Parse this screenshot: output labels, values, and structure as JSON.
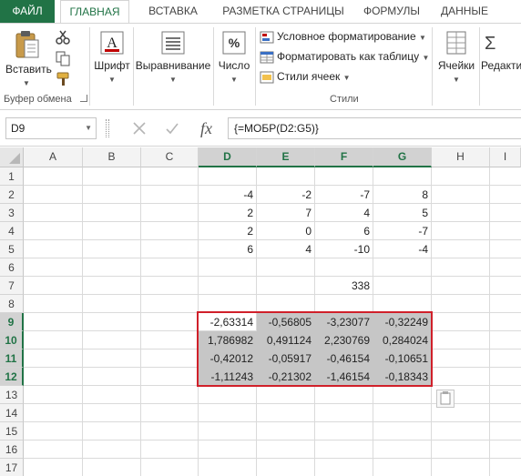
{
  "tabs": {
    "file": "ФАЙЛ",
    "home": "ГЛАВНАЯ",
    "insert": "ВСТАВКА",
    "page_layout": "РАЗМЕТКА СТРАНИЦЫ",
    "formulas": "ФОРМУЛЫ",
    "data": "ДАННЫЕ"
  },
  "ribbon": {
    "paste_label": "Вставить",
    "clipboard_group": "Буфер обмена",
    "font_label": "Шрифт",
    "alignment_label": "Выравнивание",
    "number_label": "Число",
    "conditional_formatting": "Условное форматирование",
    "format_as_table": "Форматировать как таблицу",
    "cell_styles": "Стили ячеек",
    "styles_group": "Стили",
    "cells_label": "Ячейки",
    "editing_label": "Редакти"
  },
  "formula_bar": {
    "name_box": "D9",
    "formula": "{=МОБР(D2:G5)}",
    "fx": "fx"
  },
  "columns": [
    "A",
    "B",
    "C",
    "D",
    "E",
    "F",
    "G",
    "H",
    "I"
  ],
  "rows": [
    "1",
    "2",
    "3",
    "4",
    "5",
    "6",
    "7",
    "8",
    "9",
    "10",
    "11",
    "12",
    "13",
    "14",
    "15",
    "16",
    "17"
  ],
  "selected_columns": [
    "D",
    "E",
    "F",
    "G"
  ],
  "selected_rows": [
    "9",
    "10",
    "11",
    "12"
  ],
  "matrix": [
    [
      "-4",
      "-2",
      "-7",
      "8"
    ],
    [
      "2",
      "7",
      "4",
      "5"
    ],
    [
      "2",
      "0",
      "6",
      "-7"
    ],
    [
      "6",
      "4",
      "-10",
      "-4"
    ]
  ],
  "determinant": "338",
  "inverse": [
    [
      "-2,63314",
      "-0,56805",
      "-3,23077",
      "-0,32249"
    ],
    [
      "1,786982",
      "0,491124",
      "2,230769",
      "0,284024"
    ],
    [
      "-0,42012",
      "-0,05917",
      "-0,46154",
      "-0,10651"
    ],
    [
      "-1,11243",
      "-0,21302",
      "-1,46154",
      "-0,18343"
    ]
  ],
  "colors": {
    "accent": "#217346",
    "selection_border": "#d0202a",
    "selection_fill": "#c6c6c6"
  }
}
